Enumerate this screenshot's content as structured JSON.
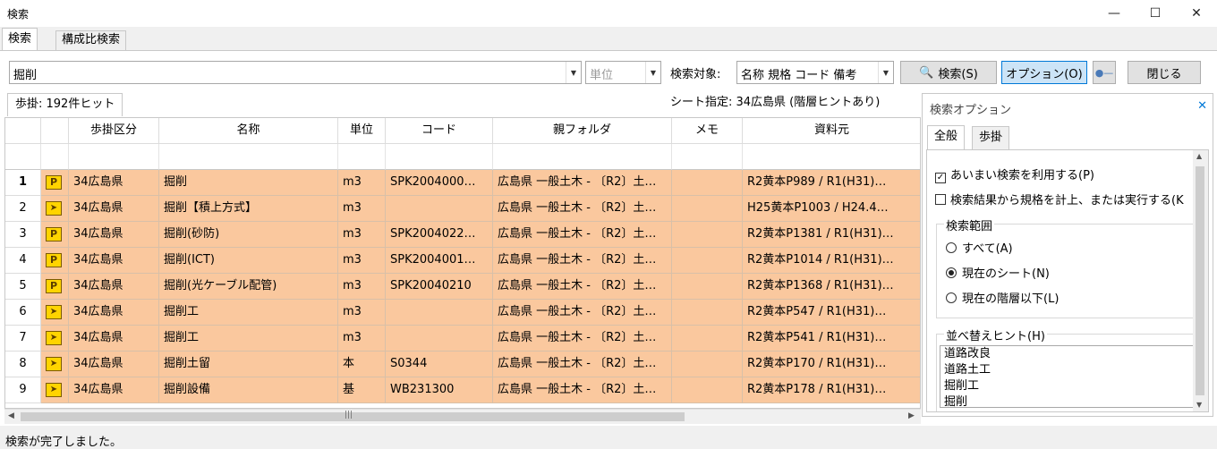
{
  "window": {
    "title": "検索"
  },
  "tabs": [
    {
      "label": "検索"
    },
    {
      "label": "構成比検索"
    }
  ],
  "toolbar": {
    "search_value": "掘削",
    "unit_placeholder": "単位",
    "target_label": "検索対象:",
    "target_value": "名称 規格 コード 備考",
    "search_button": "検索(S)",
    "option_button": "オプション(O)",
    "close_button": "閉じる",
    "sheet_spec": "シート指定: 34広島県 (階層ヒントあり)"
  },
  "result_tab": "歩掛: 192件ヒット",
  "table": {
    "headers": [
      "歩掛区分",
      "名称",
      "単位",
      "コード",
      "親フォルダ",
      "メモ",
      "資料元"
    ],
    "rows": [
      {
        "num": "1",
        "icon": "P",
        "kubun": "34広島県",
        "name": "掘削",
        "unit": "m3",
        "code": "SPK2004000…",
        "folder": "広島県 一般土木 - 〔R2〕土…",
        "memo": "",
        "source": "R2黄本P989 / R1(H31)…"
      },
      {
        "num": "2",
        "icon": "A",
        "kubun": "34広島県",
        "name": "掘削【積上方式】",
        "unit": "m3",
        "code": "",
        "folder": "広島県 一般土木 - 〔R2〕土…",
        "memo": "",
        "source": "H25黄本P1003 / H24.4…"
      },
      {
        "num": "3",
        "icon": "P",
        "kubun": "34広島県",
        "name": "掘削(砂防)",
        "unit": "m3",
        "code": "SPK2004022…",
        "folder": "広島県 一般土木 - 〔R2〕土…",
        "memo": "",
        "source": "R2黄本P1381 / R1(H31)…"
      },
      {
        "num": "4",
        "icon": "P",
        "kubun": "34広島県",
        "name": "掘削(ICT)",
        "unit": "m3",
        "code": "SPK2004001…",
        "folder": "広島県 一般土木 - 〔R2〕土…",
        "memo": "",
        "source": "R2黄本P1014 / R1(H31)…"
      },
      {
        "num": "5",
        "icon": "P",
        "kubun": "34広島県",
        "name": "掘削(光ケーブル配管)",
        "unit": "m3",
        "code": "SPK20040210",
        "folder": "広島県 一般土木 - 〔R2〕土…",
        "memo": "",
        "source": "R2黄本P1368 / R1(H31)…"
      },
      {
        "num": "6",
        "icon": "A",
        "kubun": "34広島県",
        "name": "掘削工",
        "unit": "m3",
        "code": "",
        "folder": "広島県 一般土木 - 〔R2〕土…",
        "memo": "",
        "source": "R2黄本P547 / R1(H31)…"
      },
      {
        "num": "7",
        "icon": "A",
        "kubun": "34広島県",
        "name": "掘削工",
        "unit": "m3",
        "code": "",
        "folder": "広島県 一般土木 - 〔R2〕土…",
        "memo": "",
        "source": "R2黄本P541 / R1(H31)…"
      },
      {
        "num": "8",
        "icon": "A",
        "kubun": "34広島県",
        "name": "掘削土留",
        "unit": "本",
        "code": "S0344",
        "folder": "広島県 一般土木 - 〔R2〕土…",
        "memo": "",
        "source": "R2黄本P170 / R1(H31)…"
      },
      {
        "num": "9",
        "icon": "A",
        "kubun": "34広島県",
        "name": "掘削設備",
        "unit": "基",
        "code": "WB231300",
        "folder": "広島県 一般土木 - 〔R2〕土…",
        "memo": "",
        "source": "R2黄本P178 / R1(H31)…"
      }
    ]
  },
  "options": {
    "title": "検索オプション",
    "tabs": [
      {
        "label": "全般"
      },
      {
        "label": "歩掛"
      }
    ],
    "check1": "あいまい検索を利用する(P)",
    "check2": "検索結果から規格を計上、または実行する(K",
    "range_label": "検索範囲",
    "radio_all": "すべて(A)",
    "radio_sheet": "現在のシート(N)",
    "radio_below": "現在の階層以下(L)",
    "sort_label": "並べ替えヒント(H)",
    "sort_items": [
      "道路改良",
      "道路土工",
      "掘削工",
      "掘削"
    ]
  },
  "status": "検索が完了しました。"
}
